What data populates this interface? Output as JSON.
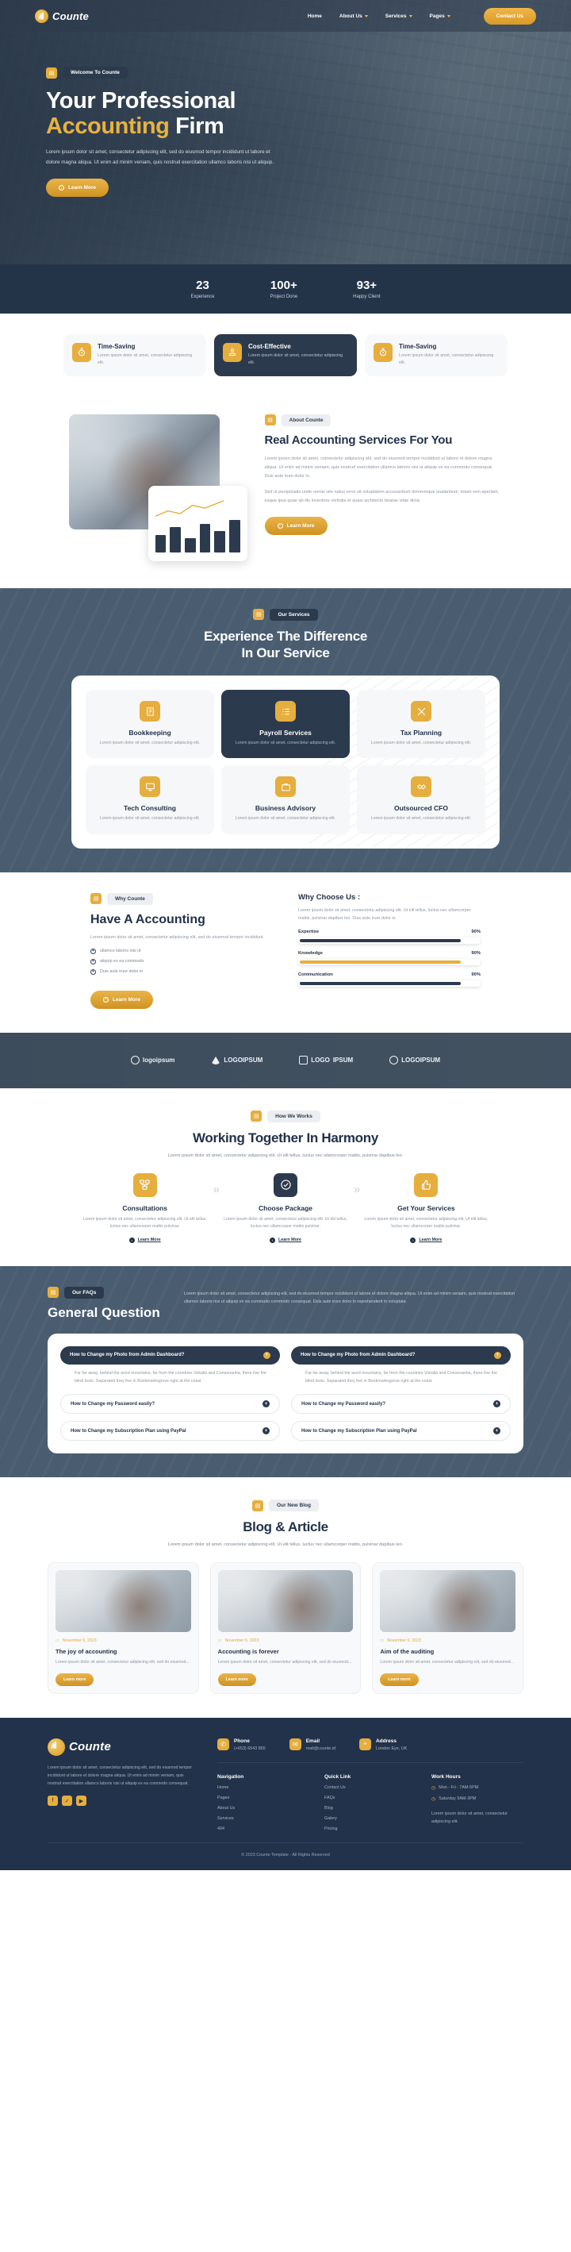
{
  "brand": {
    "name": "Counte",
    "logo_icon": "chart-logo-icon"
  },
  "nav": {
    "items": [
      {
        "label": "Home",
        "has_caret": false
      },
      {
        "label": "About Us",
        "has_caret": true
      },
      {
        "label": "Services",
        "has_caret": true
      },
      {
        "label": "Pages",
        "has_caret": true
      }
    ],
    "cta": "Contact Us"
  },
  "hero": {
    "badge": "Welcome To Counte",
    "badge_icon": "calculator-icon",
    "title_line1": "Your Professional",
    "title_accent": "Accounting",
    "title_rest": " Firm",
    "paragraph": "Lorem ipsum dolor sit amet, consectetur adipiscing elit, sed do eiusmod tempor incididunt ut labore et dolore magna aliqua. Ut enim ad minim veniam, quis nostrud exercitation ullamco laboris nisi ut aliquip.",
    "button": "Learn More"
  },
  "stats": [
    {
      "number": "23",
      "label": "Experience"
    },
    {
      "number": "100+",
      "label": "Project Done"
    },
    {
      "number": "93+",
      "label": "Happy Client"
    }
  ],
  "features": [
    {
      "title": "Time-Saving",
      "desc": "Lorem ipsum dolor sit amet, consectetur adipiscing elit.",
      "icon": "stopwatch-icon",
      "dark": false
    },
    {
      "title": "Cost-Effective",
      "desc": "Lorem ipsum dolor sit amet, consectetur adipiscing elit.",
      "icon": "hand-coin-icon",
      "dark": true
    },
    {
      "title": "Time-Saving",
      "desc": "Lorem ipsum dolor sit amet, consectetur adipiscing elit.",
      "icon": "stopwatch-icon",
      "dark": false
    }
  ],
  "about": {
    "badge": "About Counte",
    "badge_icon": "calculator-icon",
    "title": "Real Accounting Services For You",
    "p1": "Lorem ipsum dolor sit amet, consectetur adipiscing elit, sed do eiusmod tempor incididunt ut labore et dolore magna aliqua. Ut enim ad minim veniam, quis nostrud exercitation ullamco laboris nisi ut aliquip ex ea commodo consequat. Duis aute irure dolor in.",
    "p2": "Sed ut perspiciatis unde omnis iste natus error sit voluptatem accusantium doloremque laudantium, totam rem aperiam, eaque ipsa quae ab illo inventore veritatis et quasi architecto beatae vitae dicta.",
    "button": "Learn More",
    "chart_bars": [
      38,
      55,
      30,
      62,
      46,
      70
    ]
  },
  "services": {
    "badge": "Our Services",
    "badge_icon": "calculator-icon",
    "title_line1": "Experience The Difference",
    "title_line2": "In Our Service",
    "items": [
      {
        "title": "Bookkeeping",
        "desc": "Lorem ipsum dolor sit amet, consectetur adipiscing elit.",
        "icon": "ledger-book-icon",
        "dark": false
      },
      {
        "title": "Payroll Services",
        "desc": "Lorem ipsum dolor sit amet, consectetur adipiscing elit.",
        "icon": "checklist-icon",
        "dark": true
      },
      {
        "title": "Tax Planning",
        "desc": "Lorem ipsum dolor sit amet, consectetur adipiscing elit.",
        "icon": "tools-icon",
        "dark": false
      },
      {
        "title": "Tech Consulting",
        "desc": "Lorem ipsum dolor sit amet, consectetur adipiscing elit.",
        "icon": "monitor-icon",
        "dark": false
      },
      {
        "title": "Business Advisory",
        "desc": "Lorem ipsum dolor sit amet, consectetur adipiscing elit.",
        "icon": "briefcase-icon",
        "dark": false
      },
      {
        "title": "Outsourced CFO",
        "desc": "Lorem ipsum dolor sit amet, consectetur adipiscing elit.",
        "icon": "handshake-icon",
        "dark": false
      }
    ]
  },
  "why": {
    "badge": "Why Counte",
    "badge_icon": "calculator-icon",
    "title": "Have A Accounting",
    "paragraph": "Lorem ipsum dolor sit amet, consectetur adipiscing elit, sed do eiusmod tempor incididunt.",
    "ticks": [
      "ullamco laboris nisi ut",
      "aliquip ex ea commodo",
      "Duis aute irure dolor in"
    ],
    "button": "Learn More",
    "right_title": "Why Choose Us :",
    "right_paragraph": "Lorem ipsum dolor sit amet, consectetur adipiscing elit. Ut elit tellus, luctus nec ullamcorper mattis, pulvinar dapibus leo. Duis aute irure dolor in.",
    "skills": [
      {
        "label": "Expertise",
        "value": "90%",
        "pct": 90,
        "color": "#2c3a4d"
      },
      {
        "label": "Knowledge",
        "value": "90%",
        "pct": 90,
        "color": "#e5ae3e"
      },
      {
        "label": "Communication",
        "value": "90%",
        "pct": 90,
        "color": "#2c3a4d"
      }
    ]
  },
  "partners": [
    {
      "name": "logoipsum",
      "mark": "circle"
    },
    {
      "name": "LOGOIPSUM",
      "mark": "tri"
    },
    {
      "name": "LOGO",
      "mark": "sq",
      "suffix": "IPSUM"
    },
    {
      "name": "LOGOIPSUM",
      "mark": "circle"
    }
  ],
  "how": {
    "badge": "How We Works",
    "badge_icon": "calculator-icon",
    "title": "Working Together In Harmony",
    "sub": "Lorem ipsum dolor sit amet, consectetur adipiscing elit. Ut elit tellus, luctus nec ullamcorper mattis, pulvinar dapibus leo.",
    "steps": [
      {
        "title": "Consultations",
        "desc": "Lorem ipsum dolor sit amet, consectetur adipiscing elit. Ut elit tellus, luctus nec ullamcorper mattis pulvinar.",
        "icon": "network-icon",
        "link": "Learn More",
        "dark": false
      },
      {
        "title": "Choose Package",
        "desc": "Lorem ipsum dolor sit amet, consectetur adipiscing elit. Ut elit tellus, luctus nec ullamcorper mattis pulvinar.",
        "icon": "check-badge-icon",
        "link": "Learn More",
        "dark": true
      },
      {
        "title": "Get Your Services",
        "desc": "Lorem ipsum dolor sit amet, consectetur adipiscing elit. Ut elit tellus, luctus nec ullamcorper mattis pulvinar.",
        "icon": "thumbs-up-icon",
        "link": "Learn More",
        "dark": false
      }
    ],
    "chevron": "»"
  },
  "faq": {
    "badge": "Our FAQs",
    "badge_icon": "calculator-icon",
    "title": "General Question",
    "paragraph": "Lorem ipsum dolor sit amet, consectetur adipiscing elit, sed do eiusmod tempor incididunt ut labore et dolore magna aliqua. Ut enim ad minim veniam, quis nostrud exercitation ullamco laboris nisi ut aliquip ex ea commodo commodo consequat. Duis aute irure dolor in reprehenderit in voluptate.",
    "items": [
      {
        "q": "How to Change my Photo from Admin Dashboard?",
        "open": true,
        "a": "Far far away, behind the word mountains, far from the countries Vokalia and Consonantia, there live the blind texts. Separated they live in Bookmarksgrove right at the coast",
        "toggle": "+"
      },
      {
        "q": "How to Change my Photo from Admin Dashboard?",
        "open": true,
        "a": "Far far away, behind the word mountains, far from the countries Vokalia and Consonantia, there live the blind texts. Separated they live in Bookmarksgrove right at the coast",
        "toggle": "+"
      },
      {
        "q": "How to Change my Password easily?",
        "open": false,
        "a": "",
        "toggle": "+"
      },
      {
        "q": "How to Change my Password easily?",
        "open": false,
        "a": "",
        "toggle": "+"
      },
      {
        "q": "How to Change my Subscription Plan using PayPal",
        "open": false,
        "a": "",
        "toggle": "+"
      },
      {
        "q": "How to Change my Subscription Plan using PayPal",
        "open": false,
        "a": "",
        "toggle": "+"
      }
    ]
  },
  "blog": {
    "badge": "Our New Blog",
    "badge_icon": "calculator-icon",
    "title": "Blog & Article",
    "sub": "Lorem ipsum dolor sit amet, consectetur adipiscing elit. Ut elit tellus, luctus nec ullamcorper mattis, pulvinar dapibus leo.",
    "posts": [
      {
        "date": "November 6, 2023",
        "title": "The joy of accounting",
        "excerpt": "Lorem ipsum dolor sit amet, consectetur adipiscing elit, sed do eiusmod...",
        "button": "Learn more"
      },
      {
        "date": "November 6, 2023",
        "title": "Accounting is forever",
        "excerpt": "Lorem ipsum dolor sit amet, consectetur adipiscing elit, sed do eiusmod...",
        "button": "Learn more"
      },
      {
        "date": "November 6, 2023",
        "title": "Aim of the auditing",
        "excerpt": "Lorem ipsum dolor sit amet, consectetur adipiscing elit, sed do eiusmod...",
        "button": "Learn more"
      }
    ]
  },
  "footer": {
    "about": "Lorem ipsum dolor sit amet, consectetur adipiscing elit, sed do eiusmod tempor incididunt ut labore et dolore magna aliqua. Ut enim ad minim veniam, quis nostrud exercitation ullamco laboris nisi ut aliquip ex ea commodo consequat.",
    "socials": [
      {
        "name": "facebook-icon",
        "glyph": "f"
      },
      {
        "name": "twitter-icon",
        "glyph": "✓"
      },
      {
        "name": "youtube-icon",
        "glyph": "▶"
      }
    ],
    "contacts": [
      {
        "title": "Phone",
        "value": "(+653) 6543 865",
        "icon": "phone-icon"
      },
      {
        "title": "Email",
        "value": "mail@counte.id",
        "icon": "envelope-icon"
      },
      {
        "title": "Address",
        "value": "London Eye, UK",
        "icon": "location-pin-icon"
      }
    ],
    "nav_col": {
      "title": "Navigation",
      "links": [
        "Home",
        "Pages",
        "About Us",
        "Services",
        "404"
      ]
    },
    "quick_col": {
      "title": "Quick Link",
      "links": [
        "Contact Us",
        "FAQs",
        "Blog",
        "Galery",
        "Pricing"
      ]
    },
    "hours_col": {
      "title": "Work Hours",
      "rows": [
        "Mon - Fri : 7AM-5PM",
        "Saturday 9AM-3PM"
      ],
      "note": "Lorem ipsum dolor sit amet, consectetur adipiscing elit."
    },
    "copyright": "© 2023 Counte Template - All Rights Reserved"
  }
}
